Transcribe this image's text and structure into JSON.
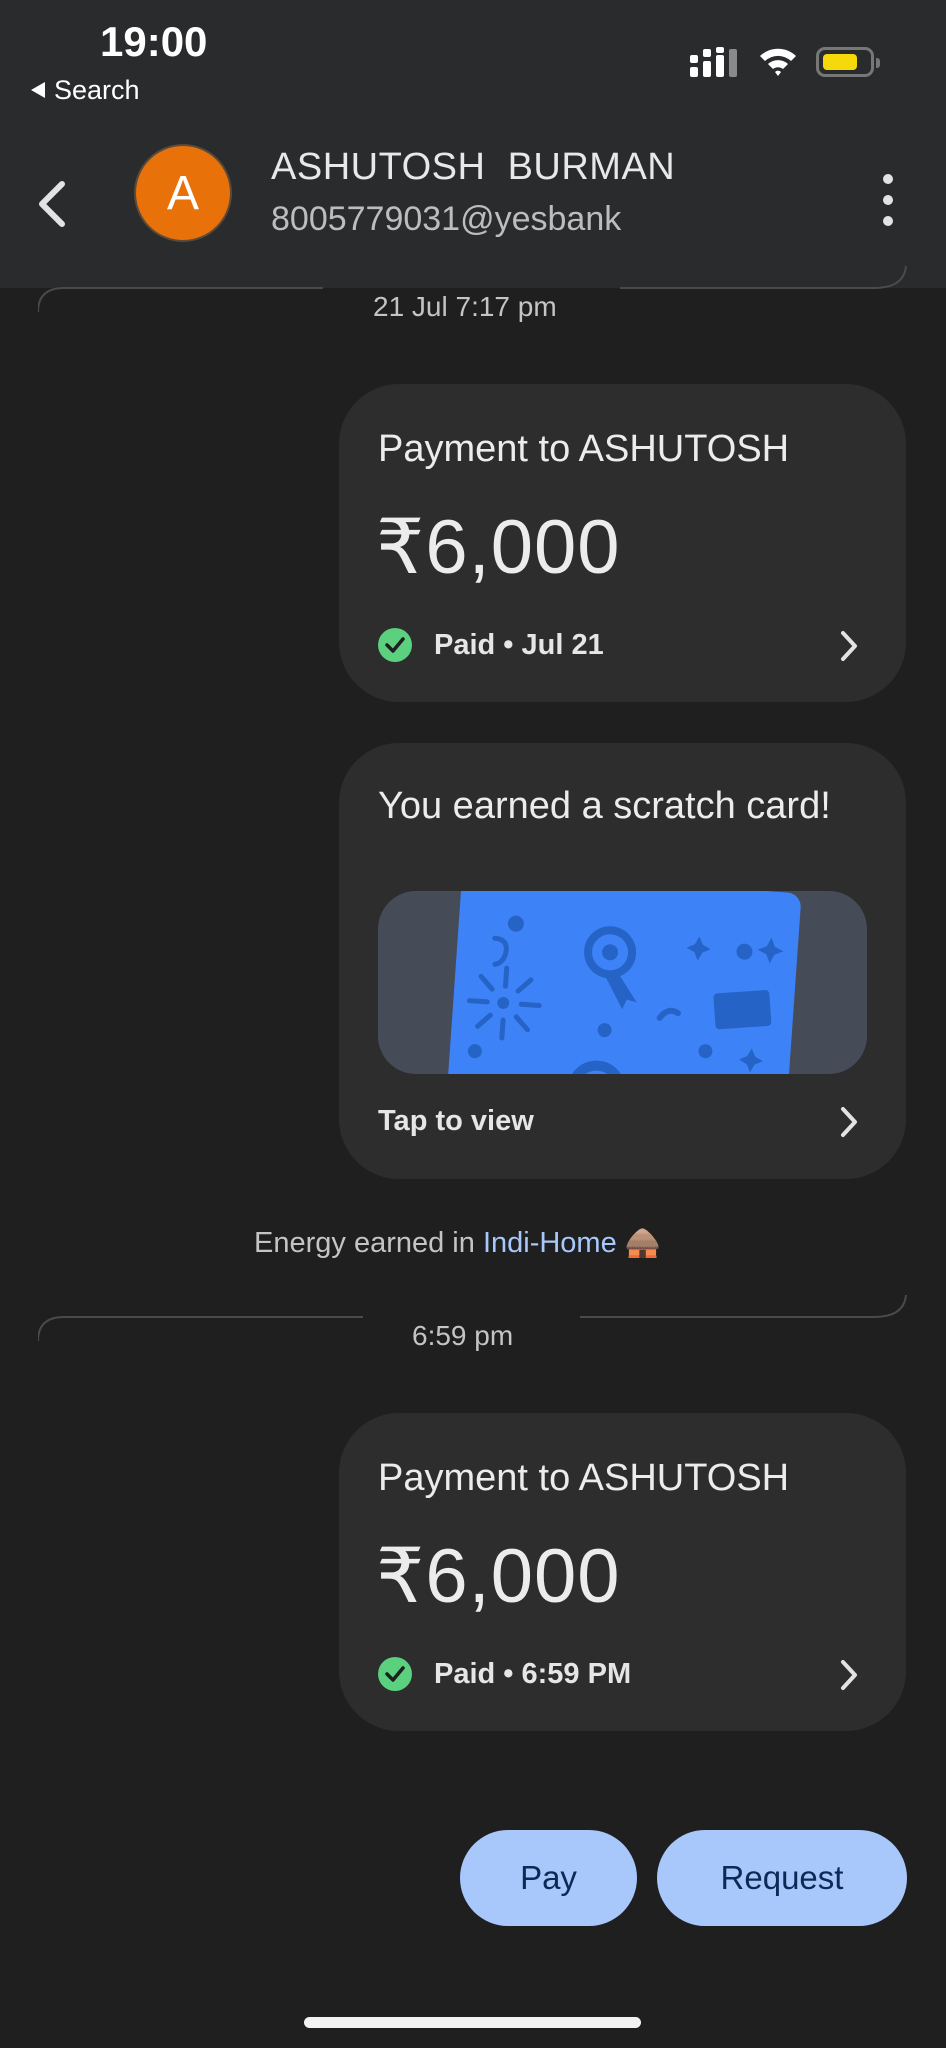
{
  "status_bar": {
    "time": "19:00",
    "back_app": "Search",
    "battery_color": "#f5d90a"
  },
  "header": {
    "avatar_initial": "A",
    "avatar_color": "#e8710a",
    "contact_name": "ASHUTOSH  BURMAN",
    "contact_handle": "8005779031@yesbank"
  },
  "timeline": [
    {
      "divider_label": "21 Jul 7:17 pm",
      "payment": {
        "title": "Payment to ASHUTOSH",
        "amount": "₹6,000",
        "status": "Paid • Jul 21"
      },
      "reward": {
        "title": "You earned a scratch card!",
        "action": "Tap to view"
      },
      "energy": {
        "prefix": "Energy earned in ",
        "link": "Indi-Home",
        "emoji": "🛖"
      }
    },
    {
      "divider_label": "6:59 pm",
      "payment": {
        "title": "Payment to ASHUTOSH",
        "amount": "₹6,000",
        "status": "Paid • 6:59 PM"
      }
    }
  ],
  "actions": {
    "pay": "Pay",
    "request": "Request"
  },
  "colors": {
    "accent": "#a8c7fa",
    "paid_check": "#5bd07e",
    "scratch_card": "#3e82f7"
  }
}
